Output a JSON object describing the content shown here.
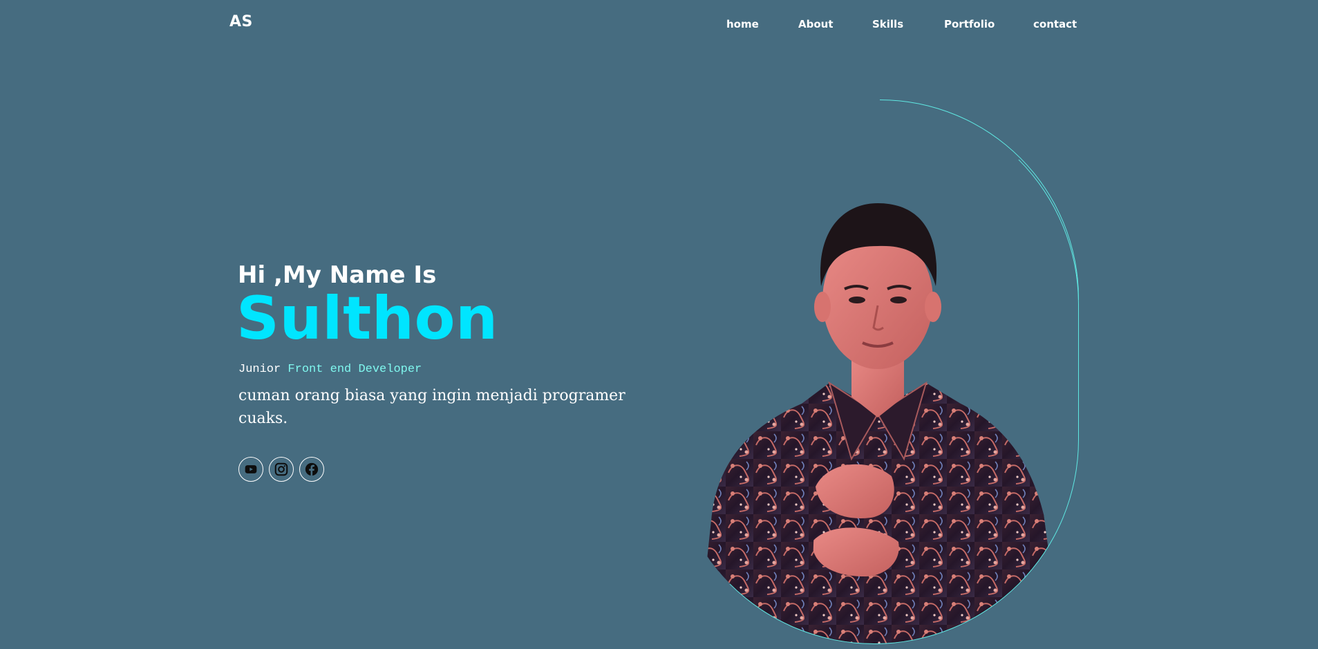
{
  "header": {
    "logo": "AS",
    "nav": [
      {
        "label": "home"
      },
      {
        "label": "About"
      },
      {
        "label": "Skills"
      },
      {
        "label": "Portfolio"
      },
      {
        "label": "contact"
      }
    ]
  },
  "hero": {
    "greeting": "Hi ,My Name Is",
    "name": "Sulthon",
    "role_prefix": "Junior",
    "role_title": "Front end Developer",
    "description": "cuman orang biasa yang ingin menjadi programer cuaks."
  },
  "socials": [
    {
      "icon": "youtube-icon"
    },
    {
      "icon": "instagram-icon"
    },
    {
      "icon": "facebook-icon"
    }
  ],
  "colors": {
    "background": "#466c80",
    "accent": "#00e5ff",
    "role_accent": "#7ff7ee",
    "frame_line": "#5fe8e2"
  }
}
